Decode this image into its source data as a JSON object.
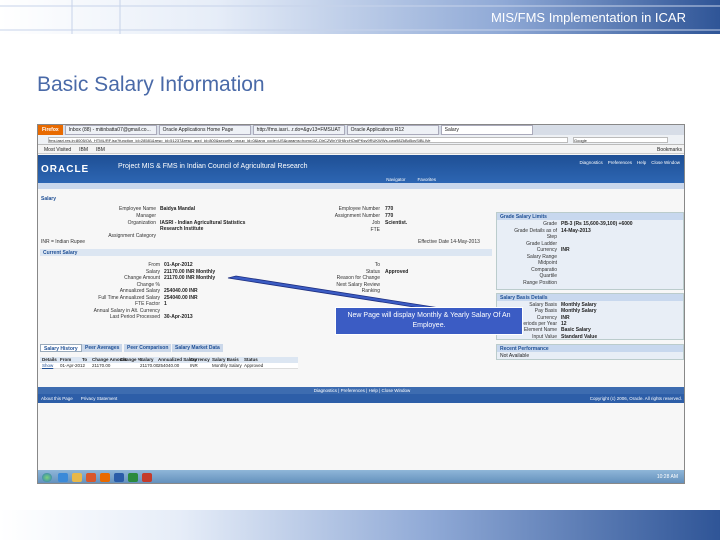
{
  "slide": {
    "header": "MIS/FMS Implementation in ICAR",
    "title": "Basic Salary Information",
    "callout": "New Page will display Monthly & Yearly Salary Of An Employee."
  },
  "browser": {
    "ff_button": "Firefox",
    "tabs": [
      "Inbox (88) - mitinbatta07@gmail.co...",
      "Oracle Applications Home Page",
      "http://fms.iasri...r.do=&gv13=FMSUAT",
      "Oracle Applications R12",
      "Salary"
    ],
    "url": "fms.iasri.res.in:8005/OA_HTML/RF.jsp?function_id=28581&resp_id=51237&resp_appl_id=800&security_group_id=0&lang_code=US&params=homy1lZ-QjrCZWnY0H8rcHQgIPKsy9RUKWWs-cwq98ZkBd5ovSjBLIVe",
    "search": "Google",
    "bookmarks": [
      "Most Visited",
      "IBM",
      "IBM"
    ],
    "bookmarks_right": "Bookmarks"
  },
  "oracle": {
    "logo": "ORACLE",
    "app_title": "Project MIS & FMS in Indian Council of Agricultural Research",
    "global": [
      "Diagnostics",
      "Preferences",
      "Help",
      "Close Window"
    ],
    "nav": [
      "Navigator",
      "Favorites"
    ],
    "page_title": "Salary"
  },
  "employee": {
    "left": [
      {
        "l": "Employee Name",
        "v": "Baidya Mandal"
      },
      {
        "l": "Manager",
        "v": ""
      },
      {
        "l": "Organization",
        "v": "IASRI - Indian Agricultural Statistics Research Institute"
      },
      {
        "l": "Assignment Category",
        "v": ""
      }
    ],
    "right": [
      {
        "l": "Employee Number",
        "v": "770"
      },
      {
        "l": "Assignment Number",
        "v": "770"
      },
      {
        "l": "Job",
        "v": "Scientist."
      },
      {
        "l": "FTE",
        "v": ""
      }
    ],
    "currency_note": "INR = Indian Rupee",
    "effective": "Effective Date 14-May-2013"
  },
  "current_salary": {
    "section": "Current Salary",
    "left": [
      {
        "l": "From",
        "v": "01-Apr-2012"
      },
      {
        "l": "Salary",
        "v": "21170.00  INR  Monthly"
      },
      {
        "l": "Change Amount",
        "v": "21170.00  INR  Monthly"
      },
      {
        "l": "Change %",
        "v": ""
      },
      {
        "l": "Annualized Salary",
        "v": "254040.00 INR"
      },
      {
        "l": "Full Time Annualized Salary",
        "v": "254040.00 INR"
      },
      {
        "l": "FTE Factor",
        "v": "1"
      },
      {
        "l": "Annual Salary in Alt. Currency",
        "v": ""
      },
      {
        "l": "Last Period Processed",
        "v": "30-Apr-2013"
      }
    ],
    "right": [
      {
        "l": "To",
        "v": ""
      },
      {
        "l": "Status",
        "v": "Approved"
      },
      {
        "l": "Reason for Change",
        "v": ""
      },
      {
        "l": "Next Salary Review",
        "v": ""
      },
      {
        "l": "Ranking",
        "v": ""
      }
    ]
  },
  "grade_limits": {
    "title": "Grade Salary Limits",
    "rows": [
      {
        "l": "Grade",
        "v": "PB-3 (Rs 15,600-39,100) +6000"
      },
      {
        "l": "Grade Details as of",
        "v": "14-May-2013"
      },
      {
        "l": "Step",
        "v": ""
      },
      {
        "l": "Grade Ladder",
        "v": ""
      },
      {
        "l": "Currency",
        "v": "INR"
      },
      {
        "l": "Salary Range",
        "v": ""
      },
      {
        "l": "Midpoint",
        "v": ""
      },
      {
        "l": "Comparatio",
        "v": ""
      },
      {
        "l": "Quartile",
        "v": ""
      },
      {
        "l": "Range Position",
        "v": ""
      }
    ]
  },
  "basis_details": {
    "title": "Salary Basis Details",
    "rows": [
      {
        "l": "Salary Basis",
        "v": "Monthly Salary"
      },
      {
        "l": "Pay Basis",
        "v": "Monthly Salary"
      },
      {
        "l": "Currency",
        "v": "INR"
      },
      {
        "l": "Pay Periods per Year",
        "v": "12"
      },
      {
        "l": "Element Name",
        "v": "Basic Salary"
      },
      {
        "l": "Input Value",
        "v": "Standard Value"
      }
    ]
  },
  "recent": {
    "title": "Recent Performance",
    "value": "Not Available"
  },
  "subtabs": [
    "Salary History",
    "Peer Averages",
    "Peer Comparison",
    "Salary Market Data"
  ],
  "history": {
    "headers": [
      "Details",
      "From",
      "To",
      "Change Amount",
      "Change %",
      "Salary",
      "Annualized Salary",
      "Currency",
      "Salary Basis",
      "Status"
    ],
    "row": [
      "Show",
      "01-Apr-2012",
      "",
      "21170.00",
      "",
      "21170.00",
      "254040.00",
      "INR",
      "Monthly Salary",
      "Approved"
    ]
  },
  "footer": {
    "links": [
      "Diagnostics",
      "Preferences",
      "Help",
      "Close Window"
    ],
    "left": [
      "About this Page",
      "Privacy Statement"
    ],
    "copyright": "Copyright (c) 2006, Oracle. All rights reserved."
  },
  "taskbar": {
    "clock": "10:28 AM"
  }
}
